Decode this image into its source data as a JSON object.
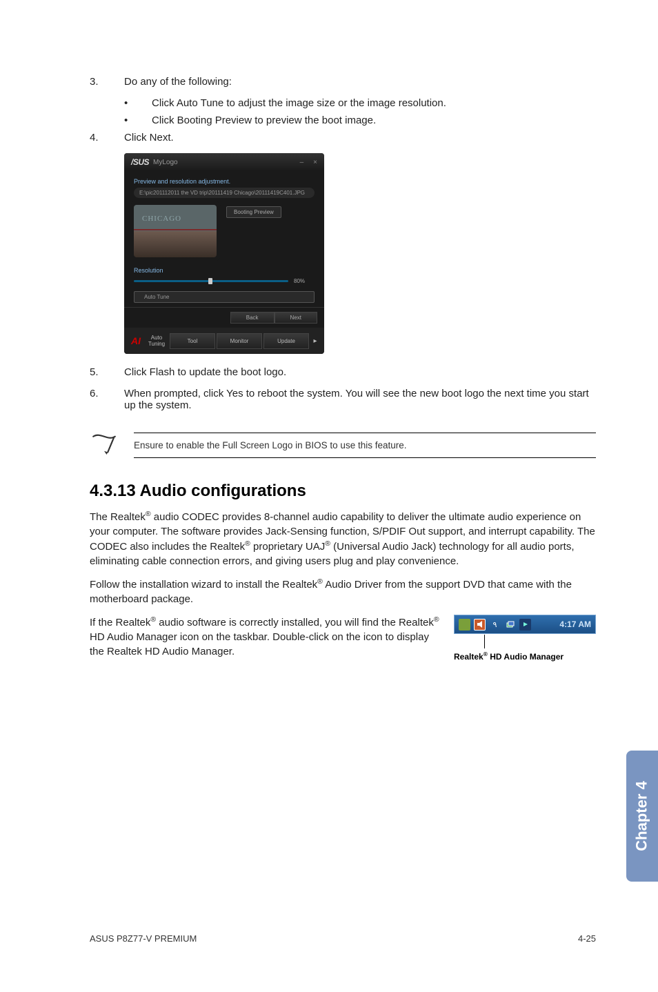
{
  "steps": {
    "s3": {
      "num": "3.",
      "text": "Do any of the following:"
    },
    "s3b1": "Click Auto Tune to adjust the image size or the image resolution.",
    "s3b2": "Click Booting Preview to preview the boot image.",
    "s4": {
      "num": "4.",
      "text": "Click Next."
    },
    "s5": {
      "num": "5.",
      "text": "Click Flash to update the boot logo."
    },
    "s6": {
      "num": "6.",
      "text": "When prompted, click Yes to reboot the system. You will see the new boot logo the next time you start up the system."
    }
  },
  "mylogo": {
    "brand": "/SUS",
    "title": "MyLogo",
    "min": "–",
    "close": "×",
    "section1": "Preview and resolution adjustment.",
    "path": "E:\\pic201112011 the VD trip\\20111419 Chicago\\20111419C401.JPG",
    "watermark": "CHICAGO",
    "booting_btn": "Booting Preview",
    "resolution_label": "Resolution",
    "slider_value": "80%",
    "autotune_btn": "Auto Tune",
    "back": "Back",
    "next": "Next",
    "ai": "AI",
    "tabs": {
      "auto": "Auto Tuning",
      "tool": "Tool",
      "monitor": "Monitor",
      "update": "Update"
    }
  },
  "note": "Ensure to enable the Full Screen Logo in BIOS to use this feature.",
  "section": {
    "heading": "4.3.13    Audio configurations",
    "p1a": "The Realtek",
    "p1b": " audio CODEC provides 8-channel audio capability to deliver the ultimate audio experience on your computer. The software provides Jack-Sensing function, S/PDIF Out support, and interrupt capability. The CODEC also includes the Realtek",
    "p1c": " proprietary UAJ",
    "p1d": " (Universal Audio Jack) technology for all audio ports, eliminating cable connection errors, and giving users plug and play convenience.",
    "p2a": "Follow the installation wizard to install the Realtek",
    "p2b": " Audio Driver from the support DVD that came with the motherboard package.",
    "p3a": "If the Realtek",
    "p3b": " audio software is correctly installed, you will find the Realtek",
    "p3c": " HD Audio Manager icon on the taskbar. Double-click on the icon to display the Realtek HD Audio Manager."
  },
  "tray": {
    "time": "4:17 AM",
    "caption_a": "Realtek",
    "caption_b": " HD Audio Manager"
  },
  "sidetab": "Chapter 4",
  "footer": {
    "left": "ASUS P8Z77-V PREMIUM",
    "right": "4-25"
  },
  "reg": "®",
  "bullet": "•"
}
